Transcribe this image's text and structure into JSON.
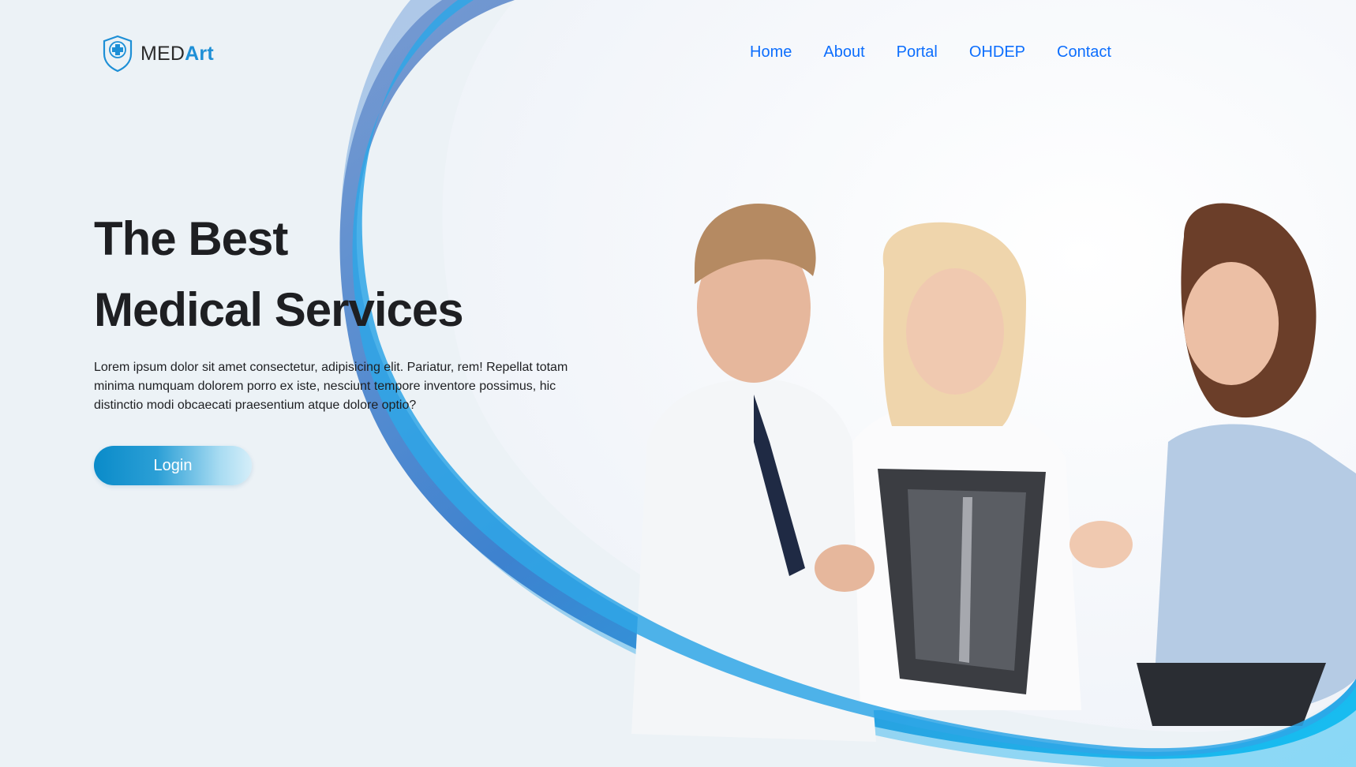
{
  "brand": {
    "name_prefix": "MED",
    "name_suffix": "Art",
    "logo_icon": "shield-cross-icon",
    "colors": {
      "accent": "#1d8fd6",
      "dark": "#2b2b2b"
    }
  },
  "nav": {
    "items": [
      {
        "label": "Home"
      },
      {
        "label": "About"
      },
      {
        "label": "Portal"
      },
      {
        "label": "OHDEP"
      },
      {
        "label": "Contact"
      }
    ],
    "color": "#0d6efd"
  },
  "hero": {
    "title_line1": "The Best",
    "title_line2": "Medical Services",
    "description": "Lorem ipsum dolor sit amet consectetur, adipisicing elit. Pariatur, rem! Repellat totam minima numquam dolorem porro ex iste, nesciunt tempore inventore possimus, hic distinctio modi obcaecati praesentium atque dolore optio?",
    "login_label": "Login",
    "image_subject": "three-doctors-examining-xray"
  },
  "theme": {
    "background": "#ecf2f6",
    "swoosh_dark": "#4a7fc9",
    "swoosh_light": "#1cbcf2",
    "title_color": "#1e1f22"
  }
}
